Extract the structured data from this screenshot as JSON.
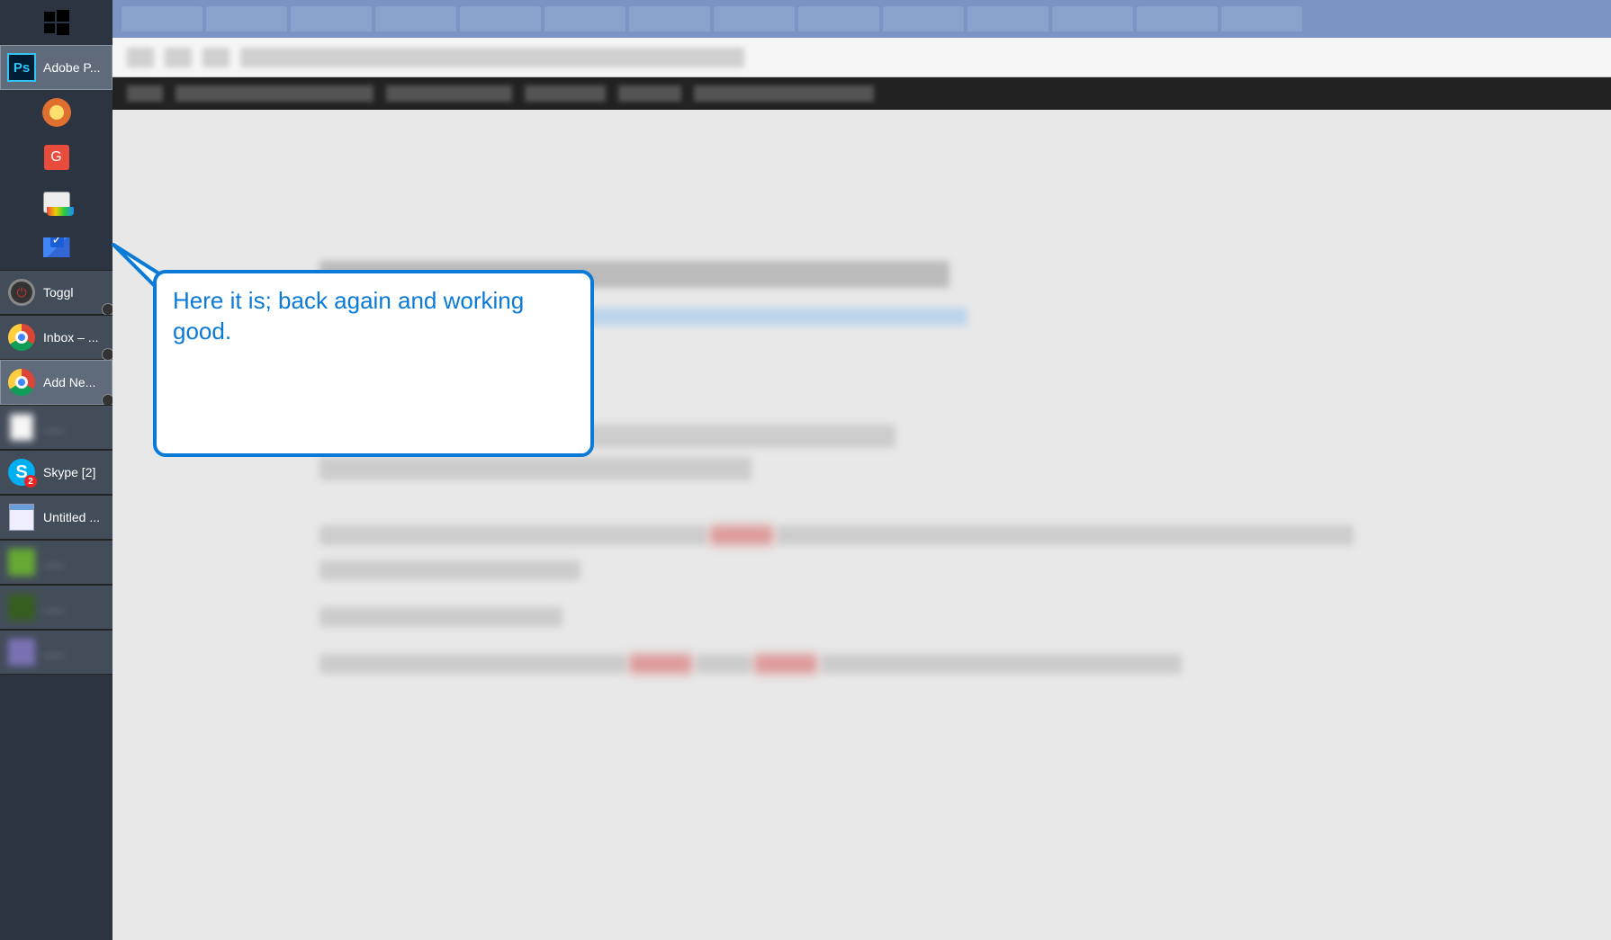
{
  "taskbar": {
    "items": [
      {
        "name": "start-button",
        "label": "",
        "icon": "start",
        "centered": true
      },
      {
        "name": "task-photoshop",
        "label": "Adobe P...",
        "icon": "ps",
        "state": "active"
      },
      {
        "name": "task-eye-app",
        "label": "",
        "icon": "eye",
        "centered": true
      },
      {
        "name": "task-g-app",
        "label": "",
        "icon": "g",
        "centered": true
      },
      {
        "name": "task-tabs-app",
        "label": "",
        "icon": "tabs",
        "centered": true
      },
      {
        "name": "task-inbox-app",
        "label": "",
        "icon": "inbox",
        "centered": true
      },
      {
        "name": "task-toggl",
        "label": "Toggl",
        "icon": "toggl",
        "state": "grouped"
      },
      {
        "name": "task-chrome-inbox",
        "label": "Inbox – ...",
        "icon": "chrome",
        "state": "grouped"
      },
      {
        "name": "task-chrome-addnew",
        "label": "Add Ne...",
        "icon": "chrome",
        "state": "active"
      },
      {
        "name": "task-blur-1",
        "label": "......",
        "icon": "file",
        "state": "grouped",
        "blur": true
      },
      {
        "name": "task-skype",
        "label": "Skype [2]",
        "icon": "skype",
        "state": "grouped",
        "skype_badge": "2"
      },
      {
        "name": "task-notepad",
        "label": "Untitled ...",
        "icon": "notepad",
        "state": "grouped"
      },
      {
        "name": "task-blur-2",
        "label": "......",
        "icon": "green",
        "state": "grouped",
        "blur": true
      },
      {
        "name": "task-blur-3",
        "label": "......",
        "icon": "darkgreen",
        "state": "grouped",
        "blur": true
      },
      {
        "name": "task-blur-4",
        "label": "......",
        "icon": "bluegray",
        "state": "grouped",
        "blur": true
      }
    ]
  },
  "callout": {
    "text": "Here it is; back again and working good."
  },
  "icons": {
    "ps_text": "Ps",
    "g_text": "G",
    "skype_text": "S",
    "toggl_text": "⏻"
  }
}
